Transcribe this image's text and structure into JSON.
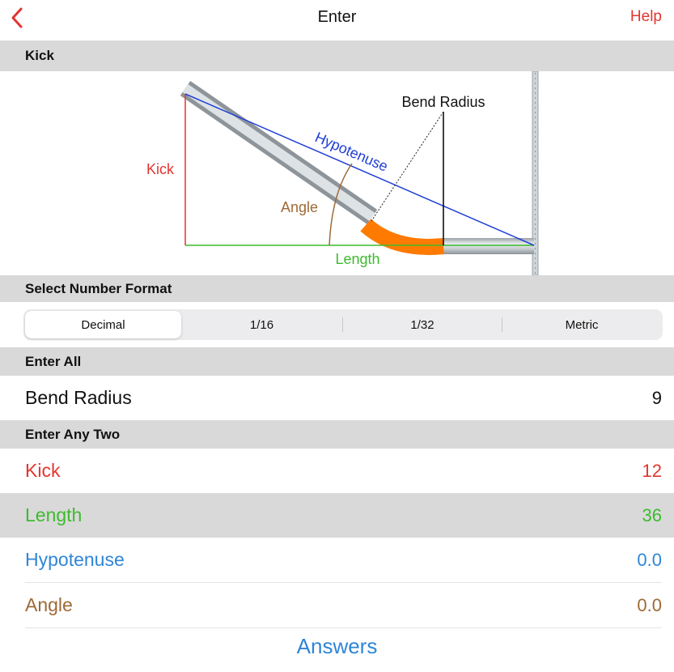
{
  "nav": {
    "title": "Enter",
    "help_label": "Help",
    "accent": "#e3352f"
  },
  "sections": {
    "kick_header": "Kick",
    "format_header": "Select Number Format",
    "enter_all_header": "Enter All",
    "enter_any_two_header": "Enter Any Two"
  },
  "diagram": {
    "bend_radius_label": "Bend Radius",
    "hypotenuse_label": "Hypotenuse",
    "kick_label": "Kick",
    "angle_label": "Angle",
    "length_label": "Length",
    "colors": {
      "kick": "#e3352f",
      "hypotenuse": "#1f3fd6",
      "length": "#3dbb2f",
      "angle": "#9e6a35",
      "bend": "#ff7a00"
    }
  },
  "format": {
    "options": [
      "Decimal",
      "1/16",
      "1/32",
      "Metric"
    ],
    "selected": "Decimal"
  },
  "bend_radius": {
    "label": "Bend Radius",
    "value": "9"
  },
  "inputs": [
    {
      "label": "Kick",
      "value": "12",
      "color": "#e3352f"
    },
    {
      "label": "Length",
      "value": "36",
      "color": "#3dbb2f"
    },
    {
      "label": "Hypotenuse",
      "value": "0.0",
      "color": "#2f86d6"
    },
    {
      "label": "Angle",
      "value": "0.0",
      "color": "#9e6a35"
    }
  ],
  "answers_label": "Answers"
}
